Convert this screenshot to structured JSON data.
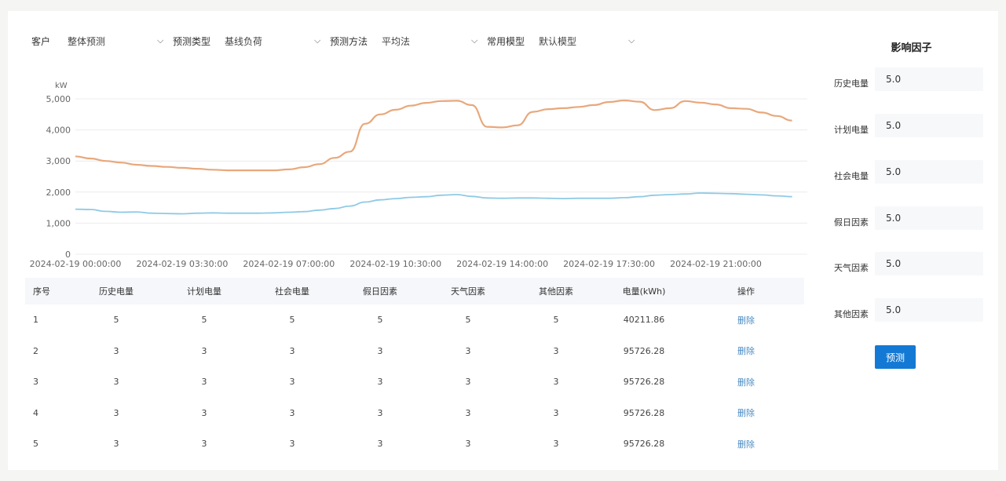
{
  "filters": [
    {
      "label": "客户",
      "value": "整体预测"
    },
    {
      "label": "预测类型",
      "value": "基线负荷"
    },
    {
      "label": "预测方法",
      "value": "平均法"
    },
    {
      "label": "常用模型",
      "value": "默认模型"
    }
  ],
  "chart_data": {
    "type": "line",
    "ylabel": "kW",
    "ylim": [
      0,
      5000
    ],
    "yticks": [
      "0",
      "1,000",
      "2,000",
      "3,000",
      "4,000",
      "5,000"
    ],
    "x_tick_labels": [
      "2024-02-19 00:00:00",
      "2024-02-19 03:30:00",
      "2024-02-19 07:00:00",
      "2024-02-19 10:30:00",
      "2024-02-19 14:00:00",
      "2024-02-19 17:30:00",
      "2024-02-19 21:00:00"
    ],
    "x_hours": [
      0,
      0.5,
      1,
      1.5,
      2,
      2.5,
      3,
      3.5,
      4,
      4.5,
      5,
      5.5,
      6,
      6.5,
      7,
      7.5,
      8,
      8.5,
      9,
      9.5,
      10,
      10.5,
      11,
      11.5,
      12,
      12.5,
      13,
      13.5,
      14,
      14.5,
      15,
      15.5,
      16,
      16.5,
      17,
      17.5,
      18,
      18.5,
      19,
      19.5,
      20,
      20.5,
      21,
      21.5,
      22,
      22.5,
      23,
      23.5
    ],
    "grid": true,
    "series": [
      {
        "color": "#e8a87c",
        "values": [
          3150,
          3080,
          3000,
          2950,
          2880,
          2840,
          2810,
          2780,
          2750,
          2720,
          2700,
          2700,
          2700,
          2700,
          2730,
          2800,
          2900,
          3100,
          3300,
          4200,
          4500,
          4650,
          4780,
          4870,
          4930,
          4940,
          4800,
          4100,
          4080,
          4150,
          4580,
          4670,
          4700,
          4740,
          4800,
          4900,
          4950,
          4910,
          4640,
          4700,
          4930,
          4880,
          4820,
          4700,
          4680,
          4560,
          4450,
          4300
        ]
      },
      {
        "color": "#8ecae6",
        "values": [
          1450,
          1440,
          1380,
          1350,
          1360,
          1320,
          1310,
          1300,
          1320,
          1330,
          1320,
          1320,
          1320,
          1330,
          1350,
          1370,
          1420,
          1470,
          1550,
          1680,
          1750,
          1790,
          1830,
          1850,
          1900,
          1920,
          1860,
          1810,
          1800,
          1810,
          1810,
          1800,
          1790,
          1800,
          1800,
          1800,
          1820,
          1850,
          1900,
          1920,
          1940,
          1970,
          1960,
          1950,
          1930,
          1910,
          1880,
          1850
        ]
      }
    ]
  },
  "table": {
    "headers": [
      "序号",
      "历史电量",
      "计划电量",
      "社会电量",
      "假日因素",
      "天气因素",
      "其他因素",
      "电量(kWh)",
      "操作"
    ],
    "rows": [
      [
        "1",
        "5",
        "5",
        "5",
        "5",
        "5",
        "5",
        "40211.86",
        "删除"
      ],
      [
        "2",
        "3",
        "3",
        "3",
        "3",
        "3",
        "3",
        "95726.28",
        "删除"
      ],
      [
        "3",
        "3",
        "3",
        "3",
        "3",
        "3",
        "3",
        "95726.28",
        "删除"
      ],
      [
        "4",
        "3",
        "3",
        "3",
        "3",
        "3",
        "3",
        "95726.28",
        "删除"
      ],
      [
        "5",
        "3",
        "3",
        "3",
        "3",
        "3",
        "3",
        "95726.28",
        "删除"
      ]
    ]
  },
  "side": {
    "title": "影响因子",
    "factors": [
      {
        "label": "历史电量",
        "value": "5.0"
      },
      {
        "label": "计划电量",
        "value": "5.0"
      },
      {
        "label": "社会电量",
        "value": "5.0"
      },
      {
        "label": "假日因素",
        "value": "5.0"
      },
      {
        "label": "天气因素",
        "value": "5.0"
      },
      {
        "label": "其他因素",
        "value": "5.0"
      }
    ],
    "button_label": "预测"
  }
}
